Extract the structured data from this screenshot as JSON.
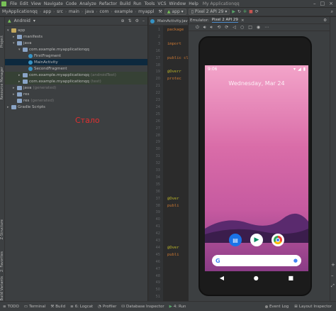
{
  "menubar": {
    "items": [
      "File",
      "Edit",
      "View",
      "Navigate",
      "Code",
      "Analyze",
      "Refactor",
      "Build",
      "Run",
      "Tools",
      "VCS",
      "Window",
      "Help"
    ],
    "title": "My Applicationqq"
  },
  "toolbar": {
    "breadcrumbs": [
      "MyApplicationqq",
      "app",
      "src",
      "main",
      "java",
      "com",
      "example",
      "myappl"
    ],
    "run_config": "app",
    "device": "Pixel 2 API 29"
  },
  "left_tool_tabs": [
    "Project",
    "Resource Manager",
    "Z-Structure",
    "2: Favorites",
    "Build Variants"
  ],
  "project": {
    "view_label": "Android",
    "tree": [
      {
        "label": "app",
        "indent": 0,
        "arrow": "▾",
        "icon": "folder-y"
      },
      {
        "label": "manifests",
        "indent": 1,
        "arrow": "▸",
        "icon": "folder"
      },
      {
        "label": "java",
        "indent": 1,
        "arrow": "▾",
        "icon": "folder"
      },
      {
        "label": "com.example.myapplicationqq",
        "indent": 2,
        "arrow": "▾",
        "icon": "folder"
      },
      {
        "label": "FirstFragment",
        "indent": 3,
        "arrow": "",
        "icon": "class"
      },
      {
        "label": "MainActivity",
        "indent": 3,
        "arrow": "",
        "icon": "class",
        "selected": true
      },
      {
        "label": "SecondFragment",
        "indent": 3,
        "arrow": "",
        "icon": "class"
      },
      {
        "label": "com.example.myapplicationqq",
        "hint": "(androidTest)",
        "indent": 2,
        "arrow": "▸",
        "icon": "folder",
        "highlight": true
      },
      {
        "label": "com.example.myapplicationqq",
        "hint": "(test)",
        "indent": 2,
        "arrow": "▸",
        "icon": "folder",
        "highlight": true
      },
      {
        "label": "java",
        "hint": "(generated)",
        "indent": 1,
        "arrow": "▸",
        "icon": "folder"
      },
      {
        "label": "res",
        "indent": 1,
        "arrow": "▸",
        "icon": "folder"
      },
      {
        "label": "res",
        "hint": "(generated)",
        "indent": 1,
        "arrow": "",
        "icon": "folder"
      },
      {
        "label": "Gradle Scripts",
        "indent": 0,
        "arrow": "▸",
        "icon": "folder"
      }
    ],
    "overlay_text": "Стало"
  },
  "editor": {
    "tab_label": "MainActivity.jav",
    "code_lines": [
      {
        "line": "1",
        "text": "package",
        "cls": "kw"
      },
      {
        "line": "2",
        "text": "",
        "cls": ""
      },
      {
        "line": "3",
        "text": "import",
        "cls": "kw"
      },
      {
        "line": "16",
        "text": "",
        "cls": ""
      },
      {
        "line": "17",
        "text": "public cl",
        "cls": "kw"
      },
      {
        "line": "18",
        "text": "",
        "cls": ""
      },
      {
        "line": "19",
        "text": "@Overr",
        "cls": "an"
      },
      {
        "line": "20",
        "text": "protec",
        "cls": "kw"
      },
      {
        "line": "21",
        "text": "",
        "cls": ""
      },
      {
        "line": "22",
        "text": "",
        "cls": ""
      },
      {
        "line": "23",
        "text": "",
        "cls": ""
      },
      {
        "line": "24",
        "text": "",
        "cls": ""
      },
      {
        "line": "25",
        "text": "",
        "cls": ""
      },
      {
        "line": "26",
        "text": "",
        "cls": ""
      },
      {
        "line": "27",
        "text": "",
        "cls": ""
      },
      {
        "line": "28",
        "text": "",
        "cls": ""
      },
      {
        "line": "29",
        "text": "",
        "cls": ""
      },
      {
        "line": "30",
        "text": "",
        "cls": ""
      },
      {
        "line": "31",
        "text": "",
        "cls": ""
      },
      {
        "line": "32",
        "text": "",
        "cls": ""
      },
      {
        "line": "33",
        "text": "",
        "cls": ""
      },
      {
        "line": "34",
        "text": "",
        "cls": ""
      },
      {
        "line": "35",
        "text": "",
        "cls": ""
      },
      {
        "line": "36",
        "text": "",
        "cls": ""
      },
      {
        "line": "37",
        "text": "@Over",
        "cls": "an"
      },
      {
        "line": "38",
        "text": "publi",
        "cls": "kw"
      },
      {
        "line": "39",
        "text": "",
        "cls": ""
      },
      {
        "line": "40",
        "text": "",
        "cls": ""
      },
      {
        "line": "41",
        "text": "",
        "cls": ""
      },
      {
        "line": "42",
        "text": "",
        "cls": ""
      },
      {
        "line": "43",
        "text": "",
        "cls": ""
      },
      {
        "line": "44",
        "text": "@Over",
        "cls": "an"
      },
      {
        "line": "45",
        "text": "publi",
        "cls": "kw"
      },
      {
        "line": "46",
        "text": "",
        "cls": ""
      },
      {
        "line": "47",
        "text": "",
        "cls": ""
      },
      {
        "line": "48",
        "text": "",
        "cls": ""
      },
      {
        "line": "49",
        "text": "",
        "cls": ""
      },
      {
        "line": "50",
        "text": "",
        "cls": ""
      },
      {
        "line": "51",
        "text": "",
        "cls": ""
      }
    ]
  },
  "emulator": {
    "tab_emulator": "Emulator:",
    "tab_device": "Pixel 2 API 29",
    "status_time": "9:06",
    "date_text": "Wednesday, Mar 24"
  },
  "bottombar": {
    "items": [
      "TODO",
      "Terminal",
      "Build",
      "6: Logcat",
      "Profiler",
      "Database Inspector",
      "4: Run"
    ],
    "right_items": [
      "Event Log",
      "Layout Inspector"
    ]
  },
  "colors": {
    "accent": "#4a88c7",
    "overlay": "#e03030"
  }
}
